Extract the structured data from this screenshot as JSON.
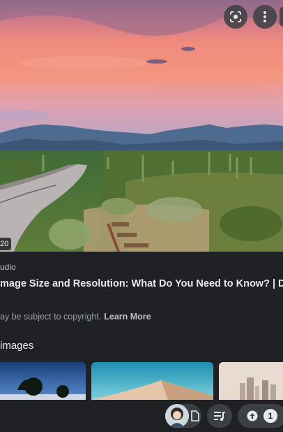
{
  "hero": {
    "size_badge": "20"
  },
  "result": {
    "source": "udio",
    "title": "mage Size and Resolution: What Do You Need to Know? | DF",
    "copyright_text": "ay be subject to copyright.",
    "learn_more": "Learn More"
  },
  "related": {
    "heading": "images"
  },
  "bottom_bar": {
    "upload_count": "1"
  },
  "icons": {
    "lens": "lens-icon",
    "more": "more-vert-icon",
    "document": "document-icon",
    "queue": "queue-music-icon",
    "upload": "upload-icon"
  },
  "colors": {
    "background": "#202124",
    "surface": "#3c4043",
    "text_primary": "#e8eaed",
    "text_secondary": "#9aa0a6"
  }
}
